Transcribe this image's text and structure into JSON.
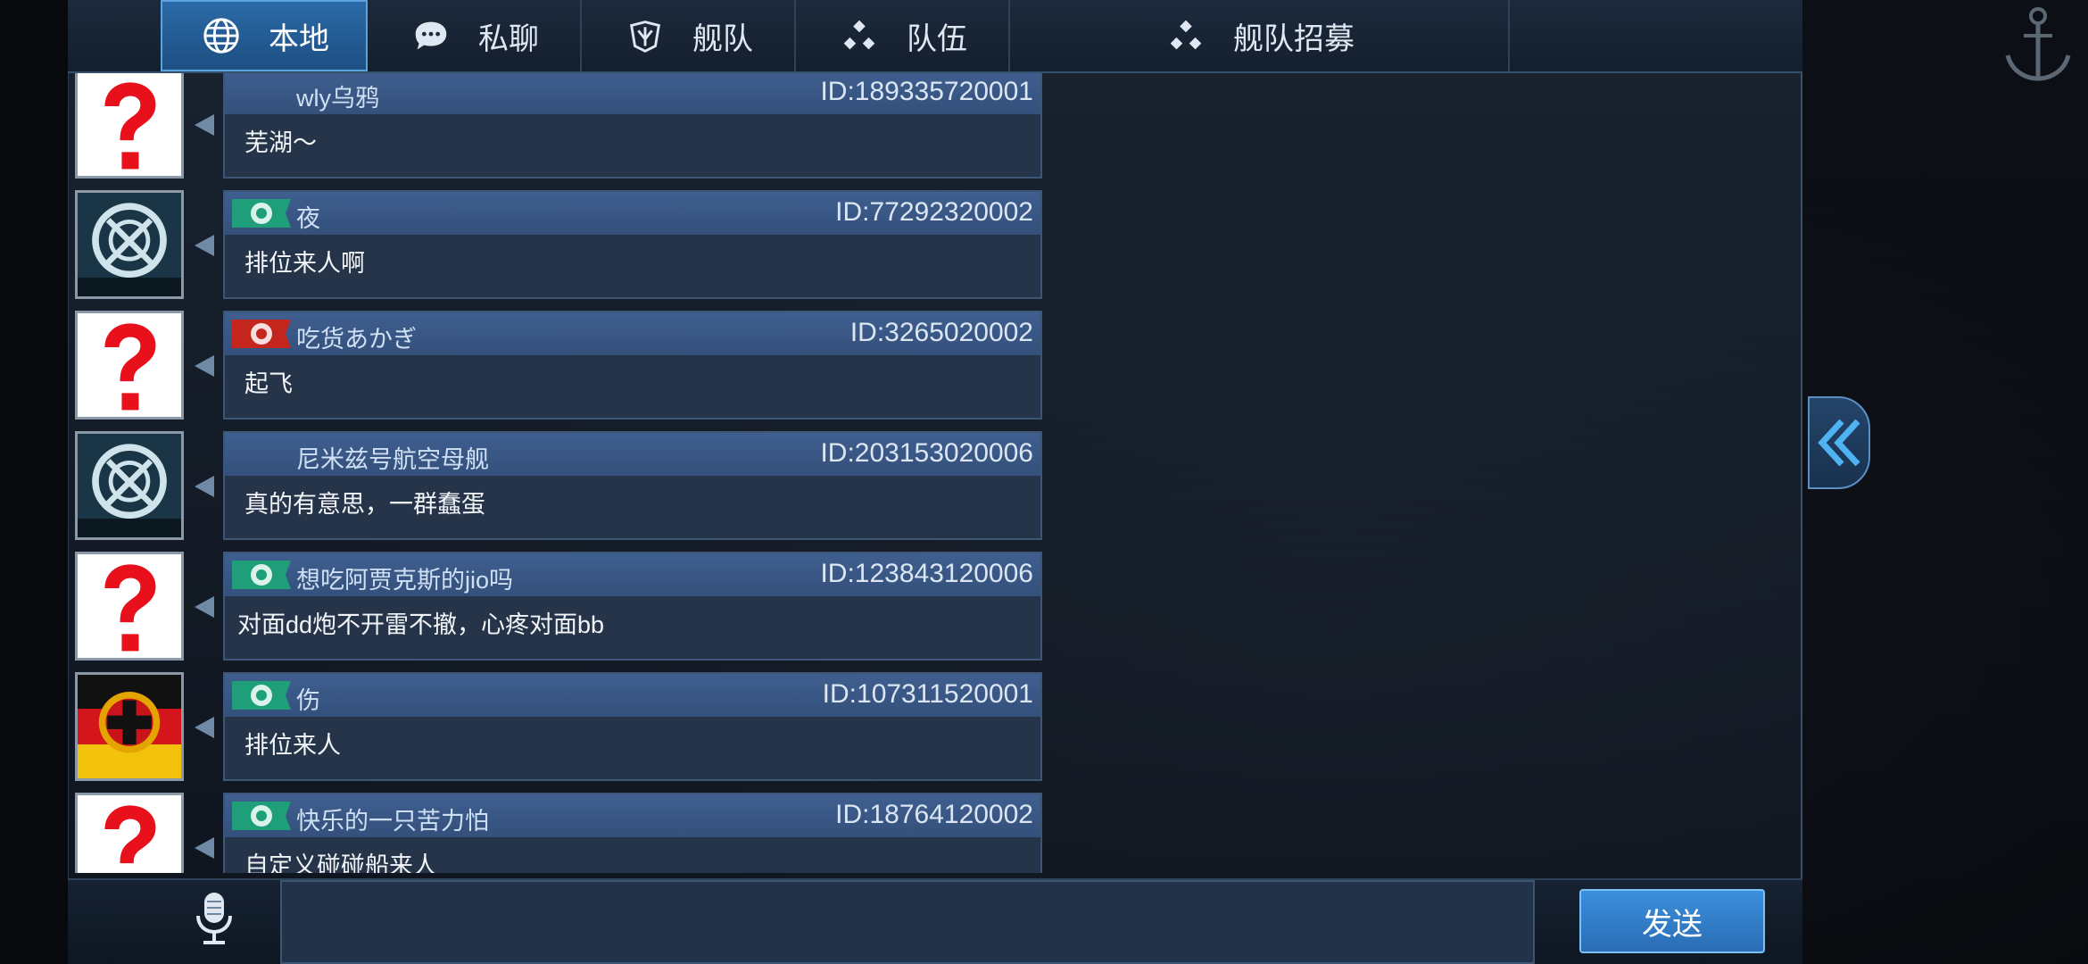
{
  "tabs": [
    {
      "label": "本地",
      "icon": "globe-icon",
      "active": true
    },
    {
      "label": "私聊",
      "icon": "chat-bubble-icon",
      "active": false
    },
    {
      "label": "舰队",
      "icon": "fleet-emblem-icon",
      "active": false
    },
    {
      "label": "队伍",
      "icon": "team-dots-icon",
      "active": false
    },
    {
      "label": "舰队招募",
      "icon": "recruit-dots-icon",
      "active": false
    }
  ],
  "messages": [
    {
      "avatar": "question-avatar",
      "flag": "",
      "name": "wly乌鸦",
      "id": "ID:189335720001",
      "text": "芜湖～"
    },
    {
      "avatar": "fleet-emblem-avatar",
      "flag": "green-flag",
      "name": "夜",
      "id": "ID:77292320002",
      "text": "排位来人啊"
    },
    {
      "avatar": "question-avatar",
      "flag": "red-flag",
      "name": "吃货あかぎ",
      "id": "ID:3265020002",
      "text": "起飞"
    },
    {
      "avatar": "fleet-emblem-avatar",
      "flag": "",
      "name": "尼米兹号航空母舰",
      "id": "ID:203153020006",
      "text": "真的有意思，一群蠢蛋"
    },
    {
      "avatar": "question-avatar",
      "flag": "green-flag",
      "name": "想吃阿贾克斯的jio吗",
      "id": "ID:123843120006",
      "text": "对面dd炮不开雷不撤，心疼对面bb"
    },
    {
      "avatar": "iron-cross-avatar",
      "flag": "green-flag",
      "name": "伤",
      "id": "ID:107311520001",
      "text": "排位来人"
    },
    {
      "avatar": "question-avatar",
      "flag": "green-flag",
      "name": "快乐的一只苦力怕",
      "id": "ID:18764120002",
      "text": "自定义碰碰船来人"
    }
  ],
  "input": {
    "value": "",
    "placeholder": ""
  },
  "send_label": "发送",
  "colors": {
    "accent": "#2b6aa7",
    "send": "#3b8fdc",
    "bubble": "#26344a",
    "header": "#3f5f90"
  }
}
